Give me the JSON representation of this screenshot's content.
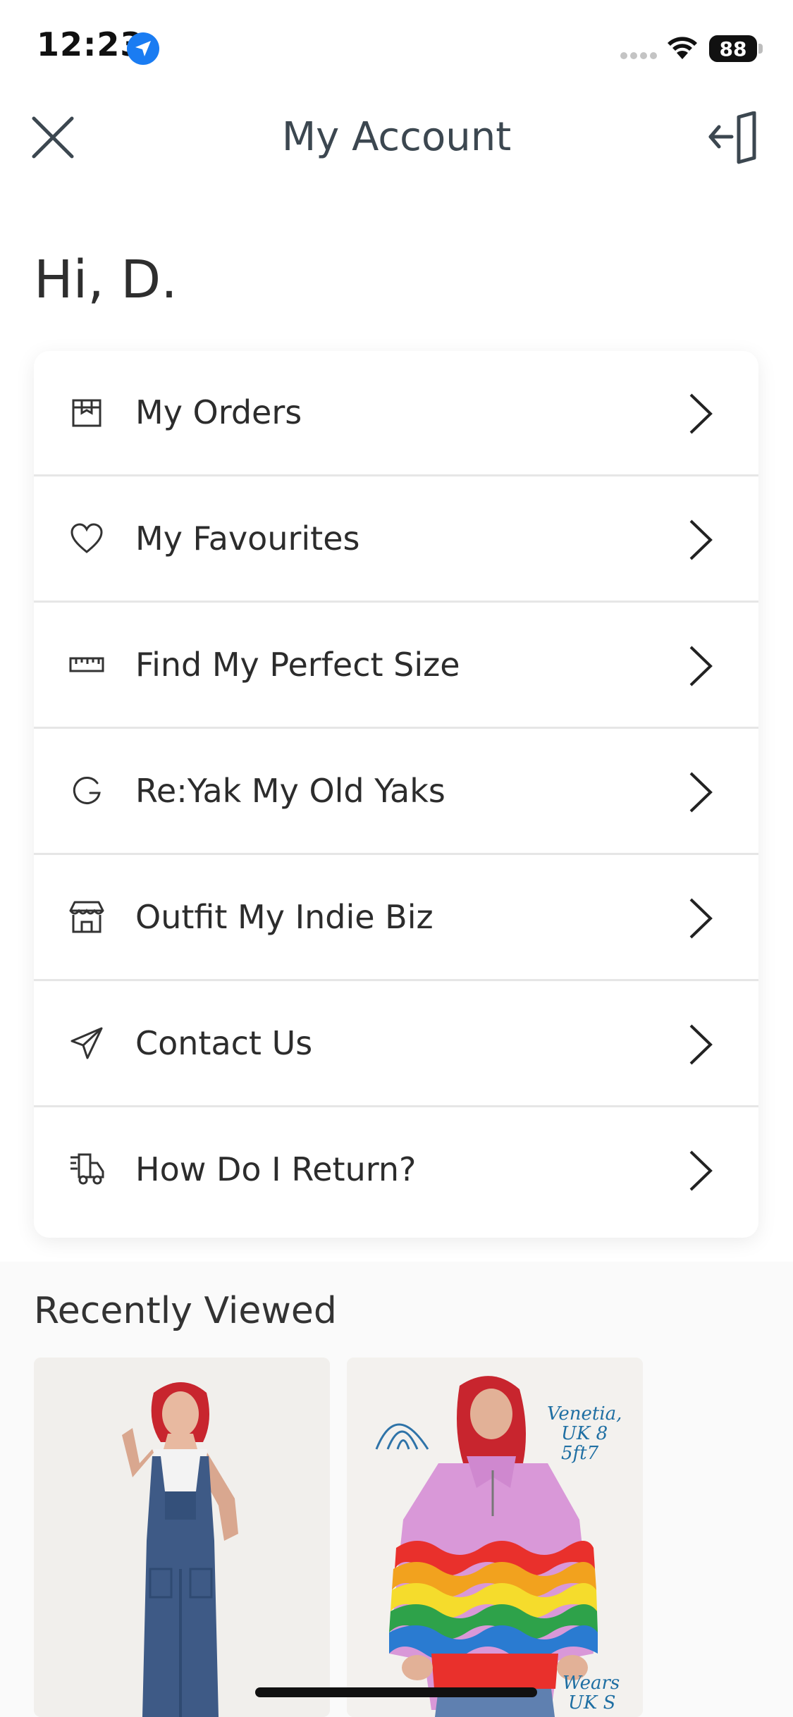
{
  "status_bar": {
    "time": "12:23",
    "battery": "88"
  },
  "header": {
    "title": "My Account"
  },
  "greeting": "Hi,  D.",
  "menu": [
    {
      "label": "My Orders",
      "icon": "box-icon"
    },
    {
      "label": "My Favourites",
      "icon": "heart-icon"
    },
    {
      "label": "Find My Perfect Size",
      "icon": "ruler-icon"
    },
    {
      "label": "Re:Yak My Old Yaks",
      "icon": "refresh-icon"
    },
    {
      "label": "Outfit My Indie Biz",
      "icon": "store-icon"
    },
    {
      "label": "Contact Us",
      "icon": "send-icon"
    },
    {
      "label": "How Do I Return?",
      "icon": "delivery-truck-icon"
    }
  ],
  "recently_viewed": {
    "title": "Recently Viewed",
    "products": [
      {
        "image": "denim-dungarees-photo"
      },
      {
        "image": "rainbow-wave-fleece-photo",
        "note_top": [
          "Venetia,",
          "UK 8",
          "5ft7"
        ],
        "note_bottom": [
          "Wears",
          "UK S"
        ]
      }
    ]
  }
}
